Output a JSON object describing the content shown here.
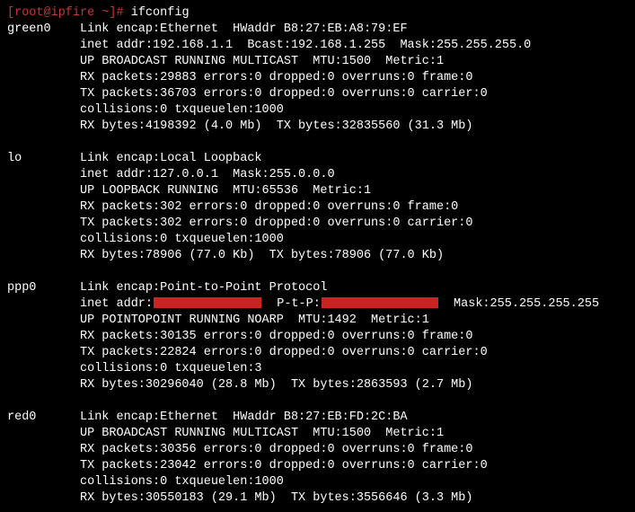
{
  "prompt": {
    "userhost": "[root@ipfire ~]# ",
    "command": "ifconfig"
  },
  "ifaces": {
    "green0": {
      "name": "green0",
      "l1": "Link encap:Ethernet  HWaddr B8:27:EB:A8:79:EF",
      "l2": "inet addr:192.168.1.1  Bcast:192.168.1.255  Mask:255.255.255.0",
      "l3": "UP BROADCAST RUNNING MULTICAST  MTU:1500  Metric:1",
      "l4": "RX packets:29883 errors:0 dropped:0 overruns:0 frame:0",
      "l5": "TX packets:36703 errors:0 dropped:0 overruns:0 carrier:0",
      "l6": "collisions:0 txqueuelen:1000",
      "l7": "RX bytes:4198392 (4.0 Mb)  TX bytes:32835560 (31.3 Mb)"
    },
    "lo": {
      "name": "lo",
      "l1": "Link encap:Local Loopback",
      "l2": "inet addr:127.0.0.1  Mask:255.0.0.0",
      "l3": "UP LOOPBACK RUNNING  MTU:65536  Metric:1",
      "l4": "RX packets:302 errors:0 dropped:0 overruns:0 frame:0",
      "l5": "TX packets:302 errors:0 dropped:0 overruns:0 carrier:0",
      "l6": "collisions:0 txqueuelen:1000",
      "l7": "RX bytes:78906 (77.0 Kb)  TX bytes:78906 (77.0 Kb)"
    },
    "ppp0": {
      "name": "ppp0",
      "l1": "Link encap:Point-to-Point Protocol",
      "l2a": "inet addr:",
      "l2b": "  P-t-P:",
      "l2c": "  Mask:255.255.255.255",
      "l3": "UP POINTOPOINT RUNNING NOARP  MTU:1492  Metric:1",
      "l4": "RX packets:30135 errors:0 dropped:0 overruns:0 frame:0",
      "l5": "TX packets:22824 errors:0 dropped:0 overruns:0 carrier:0",
      "l6": "collisions:0 txqueuelen:3",
      "l7": "RX bytes:30296040 (28.8 Mb)  TX bytes:2863593 (2.7 Mb)"
    },
    "red0": {
      "name": "red0",
      "l1": "Link encap:Ethernet  HWaddr B8:27:EB:FD:2C:BA",
      "l2": "UP BROADCAST RUNNING MULTICAST  MTU:1500  Metric:1",
      "l3": "RX packets:30356 errors:0 dropped:0 overruns:0 frame:0",
      "l4": "TX packets:23042 errors:0 dropped:0 overruns:0 carrier:0",
      "l5": "collisions:0 txqueuelen:1000",
      "l6": "RX bytes:30550183 (29.1 Mb)  TX bytes:3556646 (3.3 Mb)"
    }
  }
}
